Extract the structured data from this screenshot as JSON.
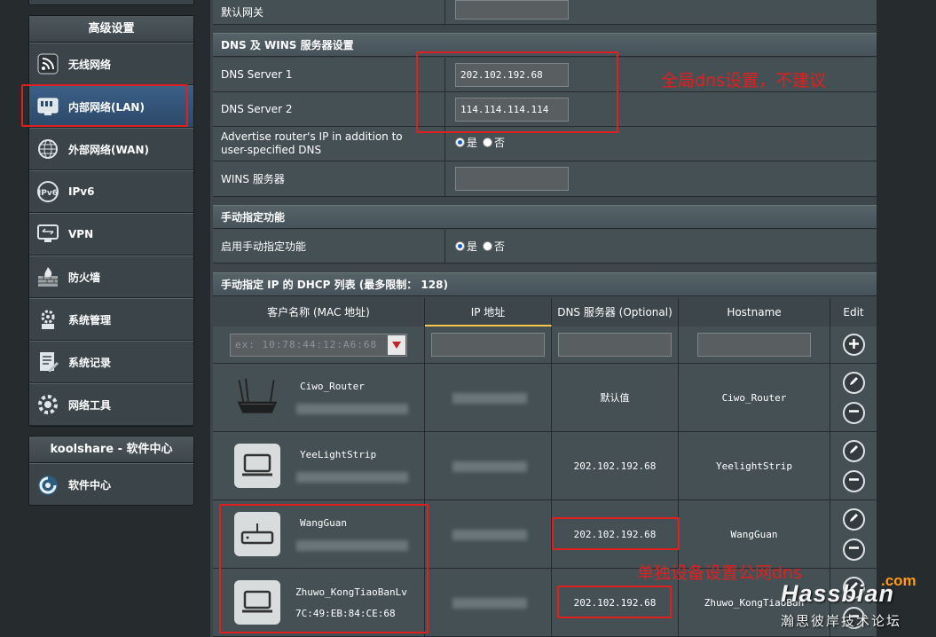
{
  "sidebar": {
    "advanced_title": "高级设置",
    "items": [
      {
        "label": "无线网络",
        "icon": "wireless-icon"
      },
      {
        "label": "内部网络(LAN)",
        "icon": "lan-icon"
      },
      {
        "label": "外部网络(WAN)",
        "icon": "globe-icon"
      },
      {
        "label": "IPv6",
        "icon": "ipv6-icon"
      },
      {
        "label": "VPN",
        "icon": "vpn-icon"
      },
      {
        "label": "防火墙",
        "icon": "firewall-icon"
      },
      {
        "label": "系统管理",
        "icon": "admin-icon"
      },
      {
        "label": "系统记录",
        "icon": "syslog-icon"
      },
      {
        "label": "网络工具",
        "icon": "tools-icon"
      }
    ],
    "koolshare_title": "koolshare - 软件中心",
    "software_center": "软件中心"
  },
  "top_row": {
    "label": "默认网关",
    "value": ""
  },
  "dns_section": {
    "title": "DNS 及 WINS 服务器设置",
    "dns1_label": "DNS Server 1",
    "dns1_value": "202.102.192.68",
    "dns2_label": "DNS Server 2",
    "dns2_value": "114.114.114.114",
    "advertise_label": "Advertise router's IP in addition to user-specified DNS",
    "yes": "是",
    "no": "否",
    "wins_label": "WINS 服务器",
    "wins_value": ""
  },
  "manual_section": {
    "title": "手动指定功能",
    "enable_label": "启用手动指定功能",
    "yes": "是",
    "no": "否"
  },
  "dhcp_list": {
    "title": "手动指定 IP 的 DHCP 列表 (最多限制： 128)",
    "headers": [
      "客户名称 (MAC 地址)",
      "IP 地址",
      "DNS 服务器 (Optional)",
      "Hostname",
      "Edit"
    ],
    "mac_placeholder": "ex: 10:78:44:12:A6:68",
    "rows": [
      {
        "name": "Ciwo_Router",
        "mac": "",
        "dns": "默认值",
        "hostname": "Ciwo_Router",
        "device_icon": "router-icon"
      },
      {
        "name": "YeeLightStrip",
        "mac": "",
        "dns": "202.102.192.68",
        "hostname": "YeelightStrip",
        "device_icon": "laptop-icon"
      },
      {
        "name": "WangGuan",
        "mac": "",
        "dns": "202.102.192.68",
        "hostname": "WangGuan",
        "device_icon": "gateway-icon"
      },
      {
        "name": "Zhuwo_KongTiaoBanLv",
        "mac": "7C:49:EB:84:CE:68",
        "dns": "202.102.192.68",
        "hostname": "Zhuwo_KongTiaoBan",
        "device_icon": "laptop-icon"
      }
    ]
  },
  "annotations": {
    "global_dns_note": "全局dns设置，不建议",
    "per_device_note": "单独设备设置公网dns"
  },
  "watermark": {
    "brand": "Hassbian",
    "domain": ".com",
    "tagline": "瀚思彼岸技术论坛"
  },
  "colors": {
    "annotation_red": "#e02020",
    "active_blue": "#2c4a6a",
    "panel_bg": "#3d474b"
  }
}
